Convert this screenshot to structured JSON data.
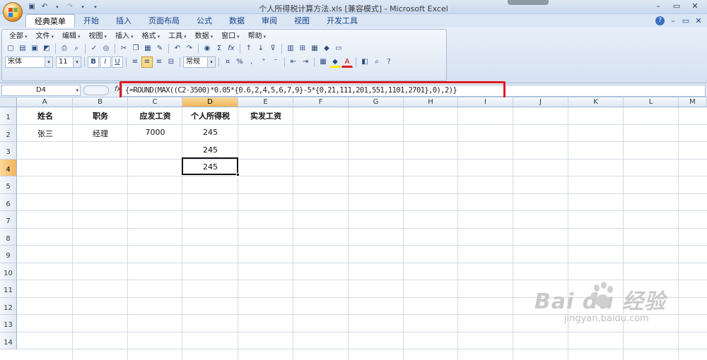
{
  "window": {
    "title": "个人所得税计算方法.xls  [兼容模式] - Microsoft Excel",
    "controls": [
      "–",
      "▭",
      "✕"
    ]
  },
  "ribbon": {
    "tabs": [
      "经典菜单",
      "开始",
      "插入",
      "页面布局",
      "公式",
      "数据",
      "审阅",
      "视图",
      "开发工具"
    ],
    "active_tab": "经典菜单",
    "menus": [
      "全部",
      "文件",
      "编辑",
      "视图",
      "插入",
      "格式",
      "工具",
      "数据",
      "窗口",
      "帮助"
    ],
    "font_name": "宋体",
    "font_size": "11",
    "number_format": "常规",
    "toolbar_labels": {
      "bold": "B",
      "italic": "I",
      "underline": "U",
      "percent": "%",
      "comma": ",",
      "sigma": "Σ",
      "fx": "fx"
    }
  },
  "formula_bar": {
    "name_box": "D4",
    "fx_label": "fx",
    "formula": "{=ROUND(MAX((C2-3500)*0.05*{0.6,2,4,5,6,7,9}-5*{0,21,111,201,551,1101,2701},0),2)}"
  },
  "grid": {
    "columns": [
      "A",
      "B",
      "C",
      "D",
      "E",
      "F",
      "G",
      "H",
      "I",
      "J",
      "K",
      "L",
      "M"
    ],
    "selected_column": "D",
    "rows": [
      "1",
      "2",
      "3",
      "4",
      "5",
      "6",
      "7",
      "8",
      "9",
      "10",
      "11",
      "12",
      "13",
      "14"
    ],
    "selected_row": "4",
    "headers": [
      "姓名",
      "职务",
      "应发工资",
      "个人所得税",
      "实发工资"
    ],
    "data_rows": [
      {
        "name": "张三",
        "title": "经理",
        "gross": "7000",
        "tax": "245"
      }
    ],
    "d3": "245",
    "d4": "245"
  },
  "watermark": {
    "main": "Bai du 经验",
    "url": "jingyan.baidu.com"
  },
  "colors": {
    "accent": "#e0191e",
    "ribbon_bg": "#dbe6f4",
    "header_selected": "#f2b45c"
  }
}
